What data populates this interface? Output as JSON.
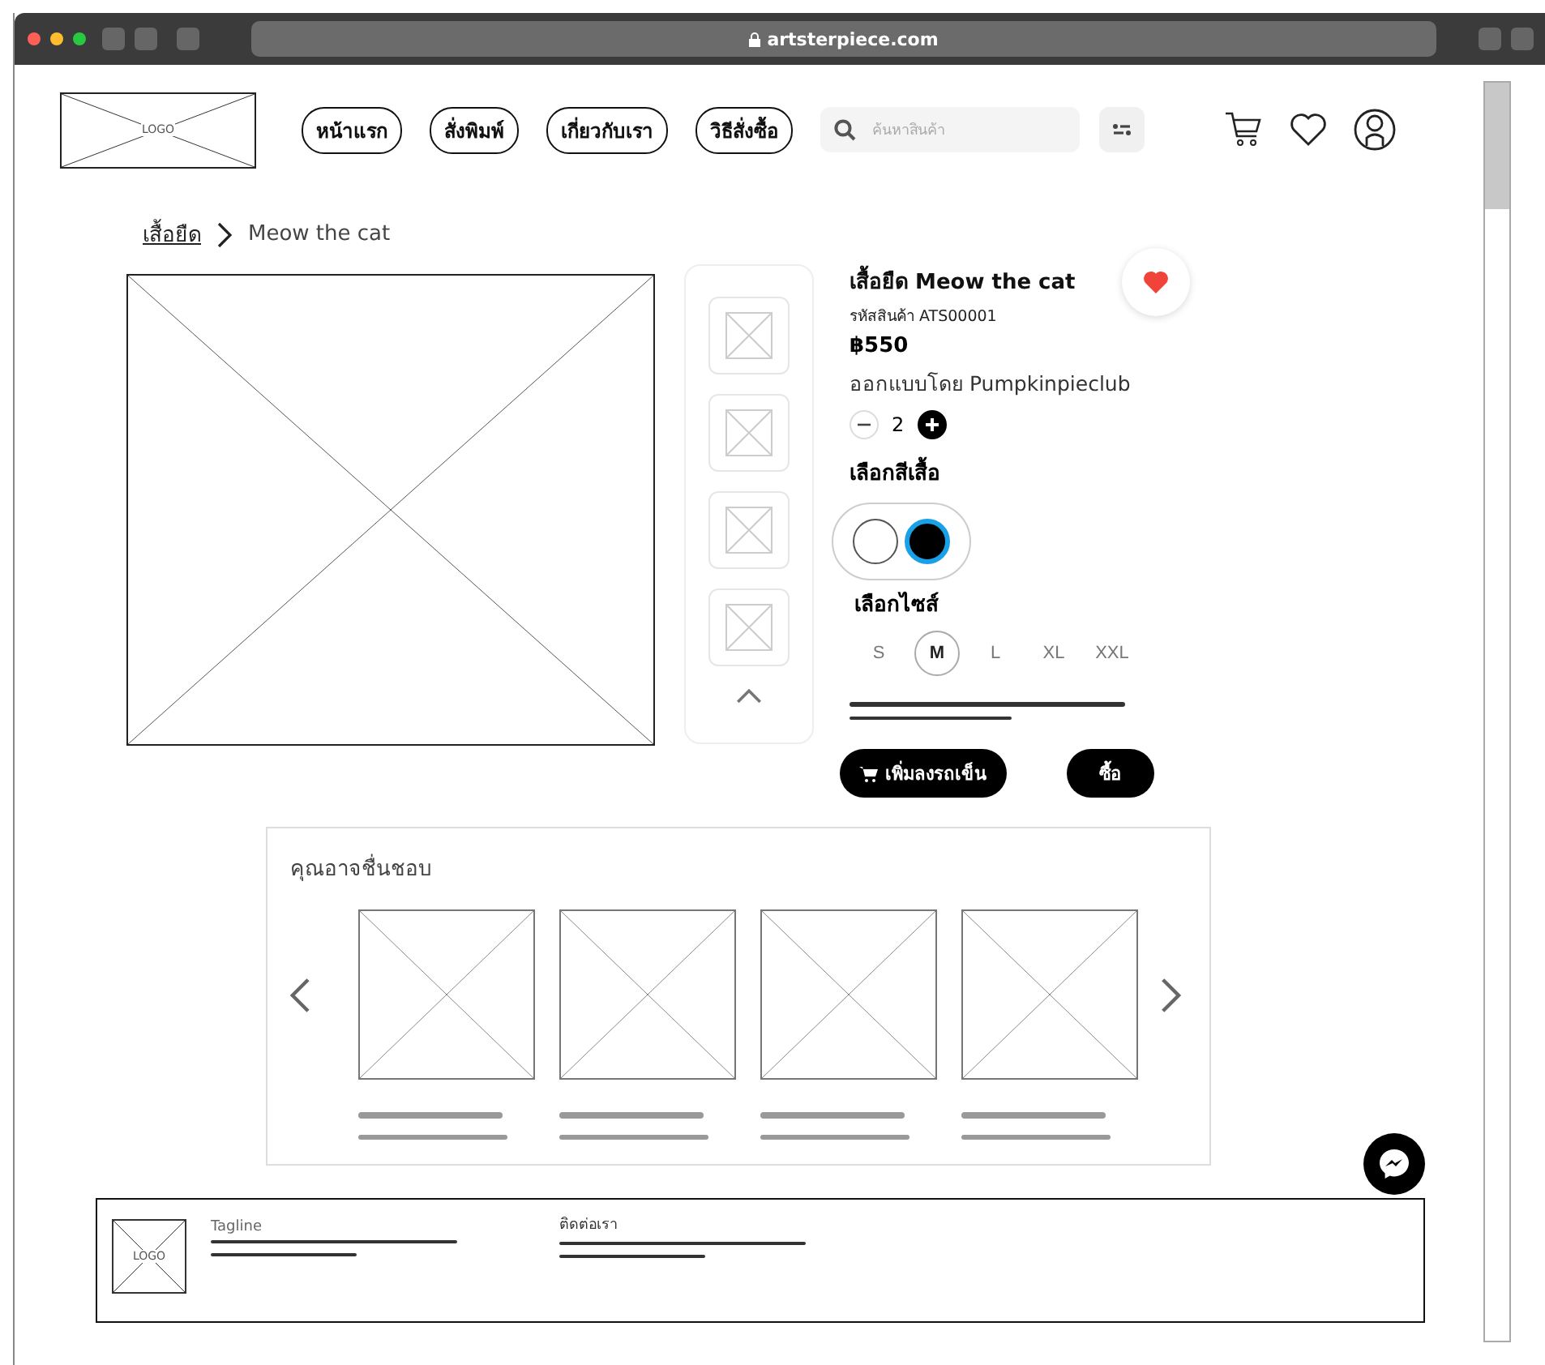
{
  "browser": {
    "url": "artsterpiece.com"
  },
  "header": {
    "logo": "LOGO",
    "nav": [
      {
        "label": "หน้าแรก"
      },
      {
        "label": "สั่งพิมพ์"
      },
      {
        "label": "เกี่ยวกับเรา"
      },
      {
        "label": "วิธีสั่งซื้อ"
      }
    ],
    "search": {
      "placeholder": "ค้นหาสินค้า"
    }
  },
  "breadcrumb": [
    {
      "label": "เสื้อยืด",
      "link": true
    },
    {
      "label": "Meow the cat",
      "link": false
    }
  ],
  "product": {
    "title": "เสื้อยืด Meow the cat",
    "code_label": "รหัสสินค้า",
    "code": "ATS00001",
    "favorite": true,
    "price": "฿550",
    "designer_label": "ออกแบบโดย",
    "designer": "Pumpkinpieclub",
    "quantity": "2",
    "color_label": "เลือกสีเสื้อ",
    "colors": [
      {
        "color": "#ffffff",
        "selected": false
      },
      {
        "color": "#000000",
        "selected": true
      }
    ],
    "size_label": "เลือกไซส์",
    "sizes": [
      {
        "label": "S",
        "selected": false
      },
      {
        "label": "M",
        "selected": true
      },
      {
        "label": "L",
        "selected": false
      },
      {
        "label": "XL",
        "selected": false
      },
      {
        "label": "XXL",
        "selected": false
      }
    ],
    "add_to_cart": "เพิ่มลงรถเข็น",
    "buy": "ซื้อ"
  },
  "recommendations": {
    "title": "คุณอาจชื่นชอบ"
  },
  "footer": {
    "logo": "LOGO",
    "tagline": "Tagline",
    "contact": "ติดต่อเรา"
  }
}
